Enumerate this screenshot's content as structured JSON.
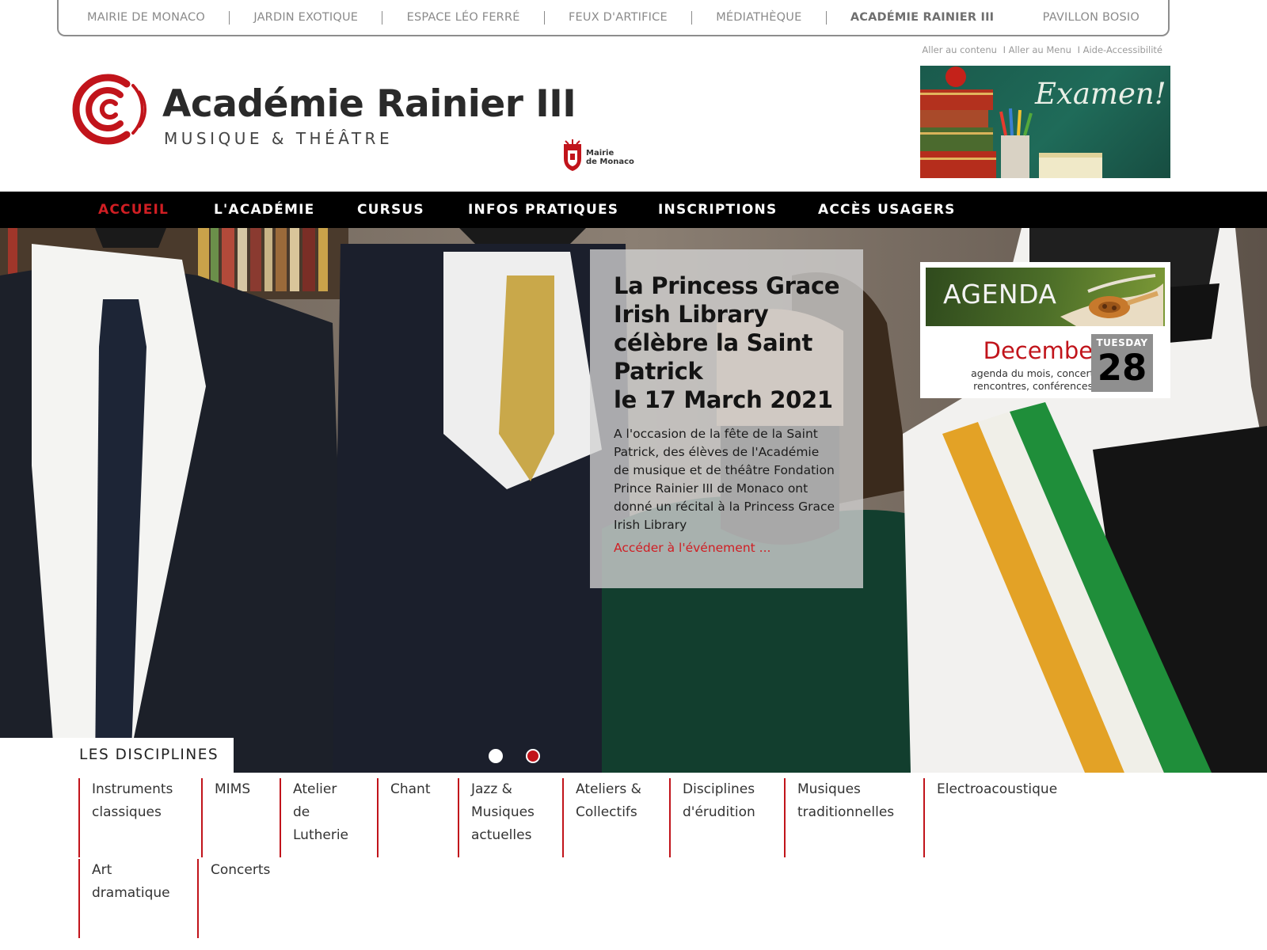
{
  "portal": {
    "items": [
      "MAIRIE DE MONACO",
      "JARDIN EXOTIQUE",
      "ESPACE LÉO FERRÉ",
      "FEUX D'ARTIFICE",
      "MÉDIATHÈQUE",
      "ACADÉMIE RAINIER III",
      "PAVILLON BOSIO"
    ]
  },
  "access": {
    "content": "Aller au contenu",
    "menu": "I Aller au Menu",
    "accessibility": "I Aide-Accessibilité"
  },
  "header": {
    "logo_title": "Académie  Rainier III",
    "logo_subtitle": "MUSIQUE & THÉÂTRE",
    "mairie_line1": "Mairie",
    "mairie_line2": "de Monaco",
    "exam_banner": "Examen!"
  },
  "nav": {
    "items": [
      "ACCUEIL",
      "L'ACADÉMIE",
      "CURSUS",
      "INFOS PRATIQUES",
      "INSCRIPTIONS",
      "ACCÈS USAGERS"
    ],
    "active_index": 0
  },
  "hero": {
    "title_lines": [
      "La Princess Grace",
      "Irish Library",
      "célèbre la Saint",
      "Patrick",
      "le 17 March 2021"
    ],
    "body_lines": [
      "A l'occasion de la fête de la Saint",
      "Patrick, des élèves de l'Académie",
      "de musique et de théâtre Fondation",
      "Prince Rainier III de Monaco ont",
      "donné un récital à la Princess Grace",
      "Irish Library"
    ],
    "link": "Accéder à l'événement ...",
    "slides": 2,
    "active_slide": 2
  },
  "agenda": {
    "label": "AGENDA",
    "month": "December",
    "desc_line1": "agenda du mois, concerts,",
    "desc_line2": "rencontres, conférences...",
    "weekday": "TUESDAY",
    "day": "28"
  },
  "disciplines": {
    "tab_label": "LES DISCIPLINES",
    "items": [
      {
        "lines": [
          "Instruments",
          "classiques"
        ]
      },
      {
        "lines": [
          "MIMS"
        ]
      },
      {
        "lines": [
          "Atelier",
          "de",
          "Lutherie"
        ]
      },
      {
        "lines": [
          "Chant"
        ]
      },
      {
        "lines": [
          "Jazz &",
          "Musiques",
          "actuelles"
        ]
      },
      {
        "lines": [
          "Ateliers &",
          "Collectifs"
        ]
      },
      {
        "lines": [
          "Disciplines",
          "d'érudition"
        ]
      },
      {
        "lines": [
          "Musiques",
          "traditionnelles"
        ]
      },
      {
        "lines": [
          "Electroacoustique"
        ]
      },
      {
        "lines": [
          "Art",
          "dramatique"
        ]
      },
      {
        "lines": [
          "Concerts"
        ]
      }
    ]
  },
  "colors": {
    "brand_red": "#c1141b",
    "nav_bg": "#000000",
    "nav_active": "#d01e23"
  }
}
